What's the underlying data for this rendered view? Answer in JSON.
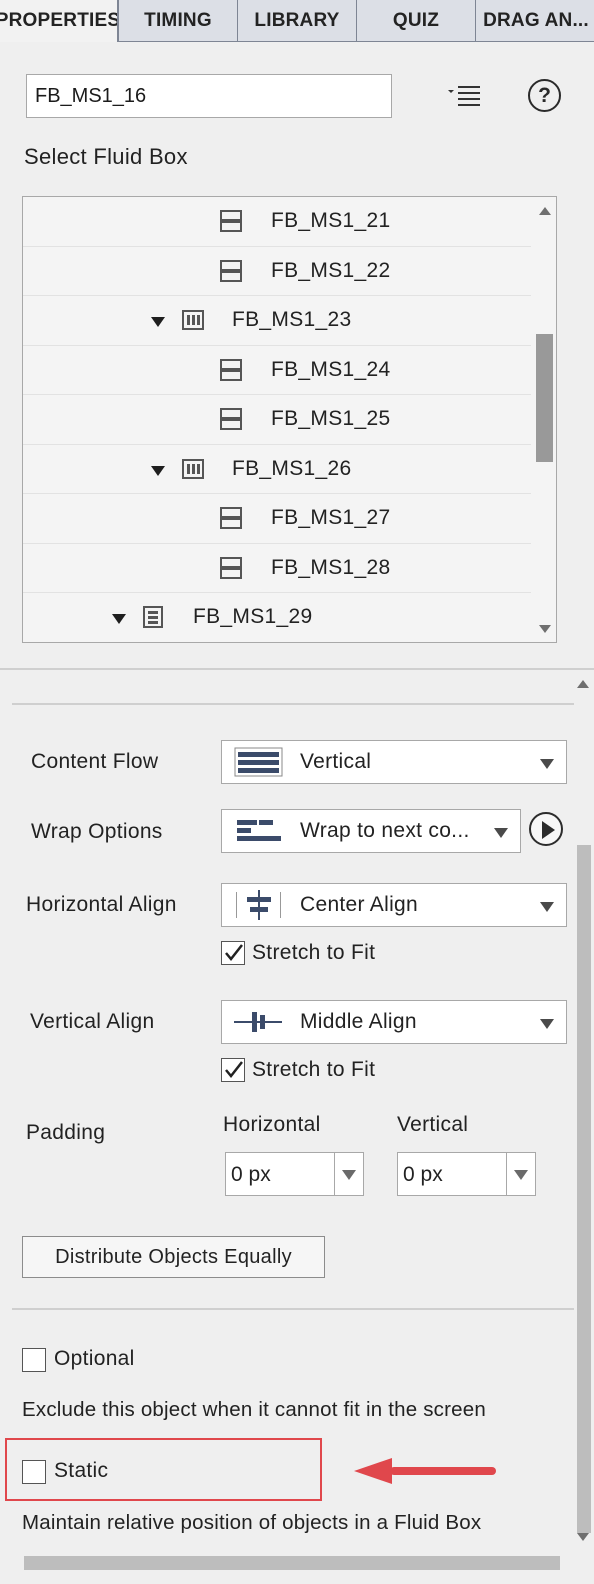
{
  "tabs": [
    {
      "label": "PROPERTIES",
      "active": true
    },
    {
      "label": "TIMING",
      "active": false
    },
    {
      "label": "LIBRARY",
      "active": false
    },
    {
      "label": "QUIZ",
      "active": false
    },
    {
      "label": "DRAG AN...",
      "active": false
    }
  ],
  "header": {
    "object_name": "FB_MS1_16",
    "menu_icon": "list-menu-icon",
    "help_icon": "help-icon",
    "help_symbol": "?"
  },
  "tree": {
    "title": "Select Fluid Box",
    "items": [
      {
        "label": "FB_MS1_21",
        "kind": "horizontal-box",
        "expandable": false
      },
      {
        "label": "FB_MS1_22",
        "kind": "horizontal-box",
        "expandable": false
      },
      {
        "label": "FB_MS1_23",
        "kind": "vertical-box",
        "expandable": true
      },
      {
        "label": "FB_MS1_24",
        "kind": "horizontal-box",
        "expandable": false
      },
      {
        "label": "FB_MS1_25",
        "kind": "horizontal-box",
        "expandable": false
      },
      {
        "label": "FB_MS1_26",
        "kind": "vertical-box",
        "expandable": true
      },
      {
        "label": "FB_MS1_27",
        "kind": "horizontal-box",
        "expandable": false
      },
      {
        "label": "FB_MS1_28",
        "kind": "horizontal-box",
        "expandable": false
      },
      {
        "label": "FB_MS1_29",
        "kind": "stacked-box",
        "expandable": true
      }
    ]
  },
  "content_flow": {
    "label": "Content Flow",
    "value": "Vertical",
    "icon": "vertical-flow-icon"
  },
  "wrap_options": {
    "label": "Wrap Options",
    "value": "Wrap to next co...",
    "icon": "wrap-icon",
    "play_icon": "play-icon"
  },
  "horizontal_align": {
    "label": "Horizontal Align",
    "value": "Center Align",
    "icon": "center-align-icon",
    "stretch_label": "Stretch to Fit",
    "stretch_checked": true
  },
  "vertical_align": {
    "label": "Vertical Align",
    "value": "Middle Align",
    "icon": "middle-align-icon",
    "stretch_label": "Stretch to Fit",
    "stretch_checked": true
  },
  "padding": {
    "label": "Padding",
    "horizontal_label": "Horizontal",
    "horizontal_value": "0 px",
    "vertical_label": "Vertical",
    "vertical_value": "0 px"
  },
  "distribute_button": "Distribute Objects Equally",
  "optional": {
    "label": "Optional",
    "checked": false,
    "description": "Exclude this object when it cannot fit in the screen"
  },
  "static": {
    "label": "Static",
    "checked": false,
    "description": "Maintain relative position of objects in a Fluid Box"
  },
  "annotation": {
    "highlight_color": "#e0474c",
    "arrow_color": "#e0474c"
  }
}
